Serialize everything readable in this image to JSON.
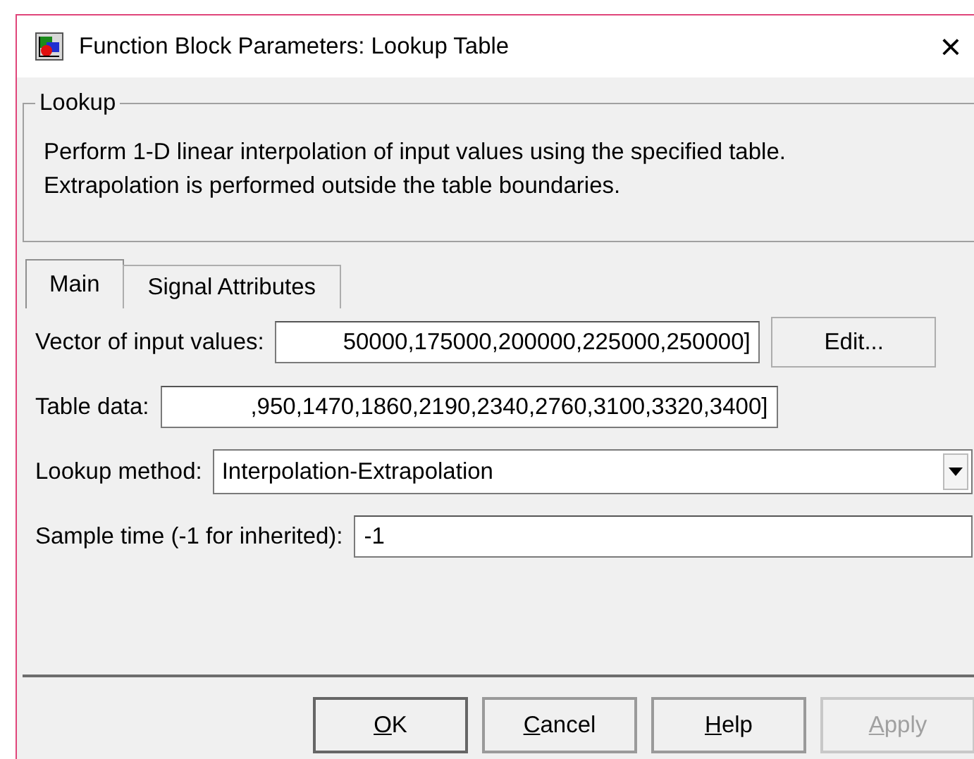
{
  "window": {
    "title": "Function Block Parameters: Lookup Table",
    "close": "×"
  },
  "group": {
    "legend": "Lookup",
    "description": [
      "Perform 1-D linear interpolation of input values using the specified table.",
      "Extrapolation is performed outside the table boundaries."
    ]
  },
  "tabs": [
    {
      "label": "Main",
      "selected": true
    },
    {
      "label": "Signal Attributes",
      "selected": false
    }
  ],
  "params": [
    {
      "kind": "text",
      "label": "Vector of input values:",
      "value": "50000,175000,200000,225000,250000]",
      "button": "Edit..."
    },
    {
      "kind": "text",
      "label": "Table data:",
      "value": ",950,1470,1860,2190,2340,2760,3100,3320,3400]"
    },
    {
      "kind": "dropdown",
      "label": "Lookup method:",
      "value": "Interpolation-Extrapolation"
    },
    {
      "kind": "text",
      "label": "Sample time (-1 for inherited):",
      "value": "-1"
    }
  ],
  "buttons": [
    {
      "label": "OK",
      "mnemonic_first": true,
      "disabled": false
    },
    {
      "label": "Cancel",
      "mnemonic_first": true,
      "disabled": false
    },
    {
      "label": "Help",
      "mnemonic_first": true,
      "disabled": false
    },
    {
      "label": "Apply",
      "mnemonic_first": true,
      "disabled": true
    }
  ]
}
